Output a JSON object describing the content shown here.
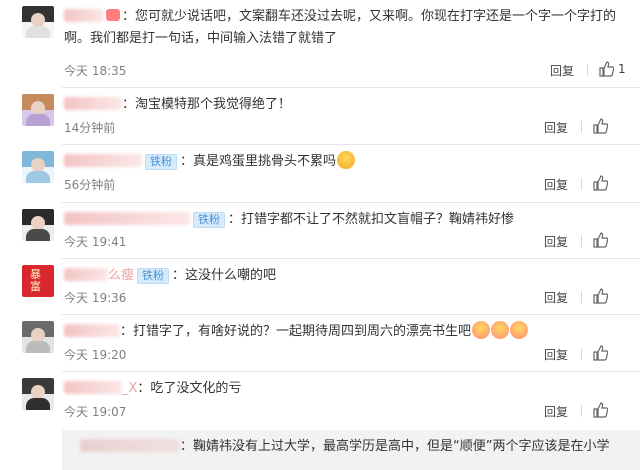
{
  "comments": [
    {
      "text": "：您可就少说话吧，文案翻车还没过去呢，又来啊。你现在打字还是一个字一个字打的啊。我们都是打一句话，中间输入法错了就错了",
      "time": "今天 18:35",
      "reply": "回复",
      "likes": "1"
    },
    {
      "text": "：淘宝模特那个我觉得绝了！",
      "time": "14分钟前",
      "reply": "回复"
    },
    {
      "badge": "铁粉",
      "text": "：真是鸡蛋里挑骨头不累吗",
      "time": "56分钟前",
      "reply": "回复"
    },
    {
      "badge": "铁粉",
      "text": "：打错字都不让了不然就扣文盲帽子？鞠婧祎好惨",
      "time": "今天 19:41",
      "reply": "回复"
    },
    {
      "name_visible": "么瘦",
      "badge": "铁粉",
      "text": "：这没什么嘲的吧",
      "time": "今天 19:36",
      "reply": "回复"
    },
    {
      "text": "：打错字了，有啥好说的？一起期待周四到周六的漂亮书生吧",
      "time": "今天 19:20",
      "reply": "回复"
    },
    {
      "name_visible": "_X",
      "text": "：吃了没文化的亏",
      "time": "今天 19:07",
      "reply": "回复"
    }
  ],
  "nested_reply": {
    "text": "：鞠婧祎没有上过大学，最高学历是高中，但是“顺便”两个字应该是在小学"
  },
  "colors": {
    "badge_bg": "#d6ecfb",
    "badge_text": "#4a90d9",
    "meta_text": "#808080"
  },
  "icons": [
    "thumb-up-icon",
    "smiley-emoji-icon",
    "fan-badge-icon"
  ]
}
